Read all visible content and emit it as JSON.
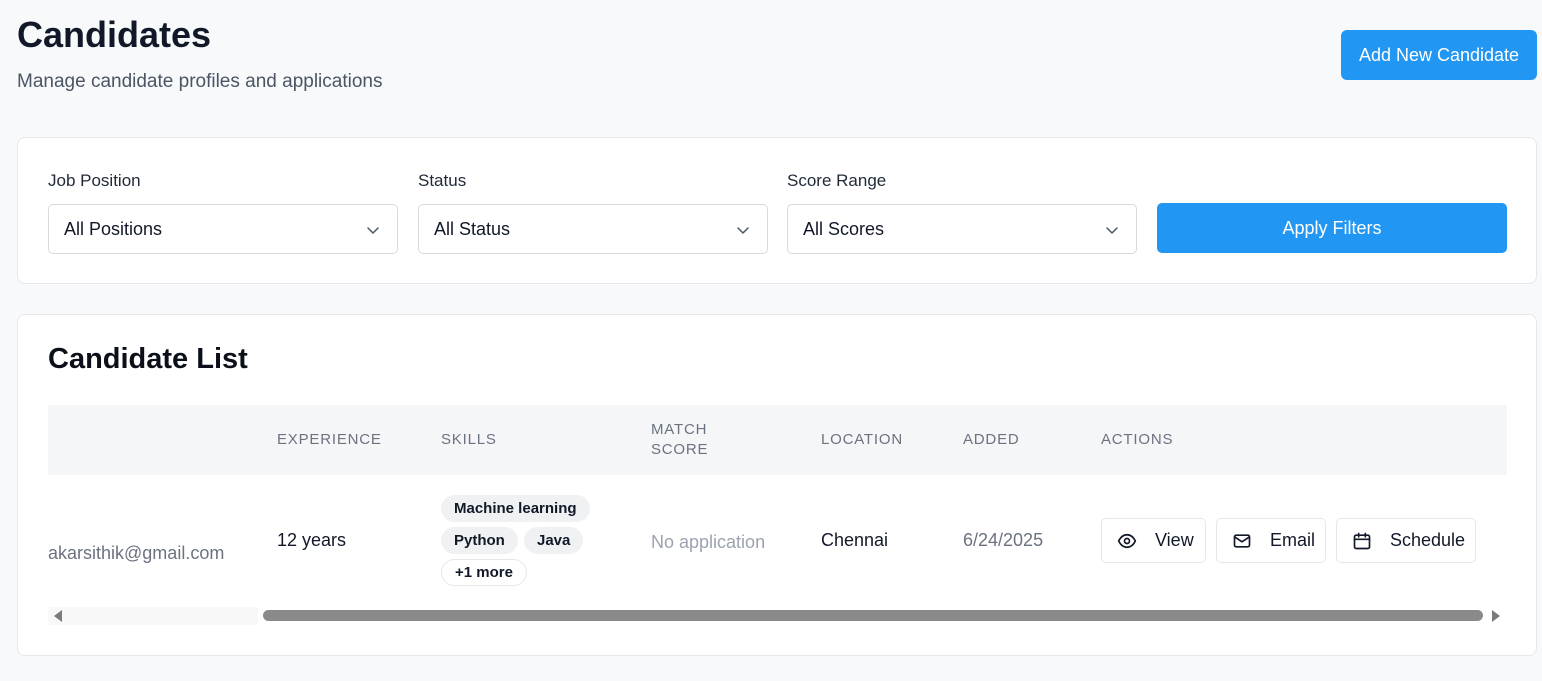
{
  "header": {
    "title": "Candidates",
    "subtitle": "Manage candidate profiles and applications",
    "add_button": "Add New Candidate"
  },
  "filters": {
    "job_position": {
      "label": "Job Position",
      "value": "All Positions"
    },
    "status": {
      "label": "Status",
      "value": "All Status"
    },
    "score_range": {
      "label": "Score Range",
      "value": "All Scores"
    },
    "apply_button": "Apply Filters"
  },
  "candidate_list": {
    "title": "Candidate List",
    "columns": {
      "experience": "EXPERIENCE",
      "skills": "SKILLS",
      "match_score_1": "MATCH",
      "match_score_2": "SCORE",
      "location": "LOCATION",
      "added": "ADDED",
      "actions": "ACTIONS"
    },
    "rows": [
      {
        "email": "akarsithik@gmail.com",
        "experience": "12 years",
        "skills": [
          "Machine learning",
          "Python",
          "Java"
        ],
        "more_skills": "+1 more",
        "match_score": "No application",
        "location": "Chennai",
        "added": "6/24/2025",
        "actions": {
          "view": "View",
          "email": "Email",
          "schedule": "Schedule"
        }
      }
    ]
  },
  "colors": {
    "primary": "#2196f3",
    "page_bg": "#f8f9fb"
  }
}
